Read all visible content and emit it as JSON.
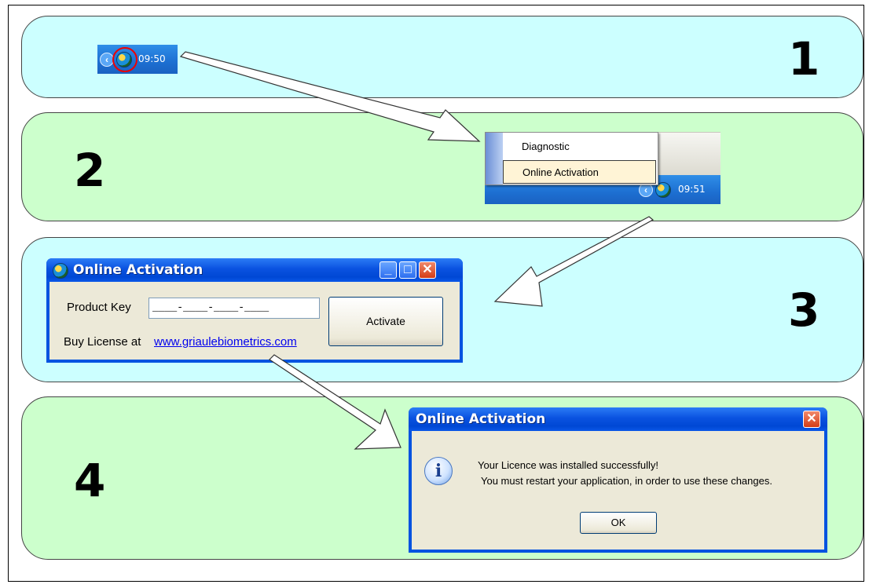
{
  "steps": [
    "1",
    "2",
    "3",
    "4"
  ],
  "step1": {
    "tray_time": "09:50"
  },
  "step2": {
    "menu_items": [
      "Diagnostic",
      "Online Activation"
    ],
    "tray_time": "09:51"
  },
  "step3": {
    "window_title": "Online Activation",
    "product_key_label": "Product Key",
    "product_key_value": "____-____-____-____",
    "activate_label": "Activate",
    "buy_license_text": "Buy License at",
    "buy_license_link": "www.griaulebiometrics.com",
    "minimize_glyph": "_",
    "maximize_glyph": "□",
    "close_glyph": "✕"
  },
  "step4": {
    "window_title": "Online Activation",
    "message_line1": "Your Licence was installed successfully!",
    "message_line2": "You must restart your application, in order to use these changes.",
    "ok_label": "OK",
    "close_glyph": "✕",
    "info_glyph": "i"
  },
  "chevron_glyph": "‹",
  "colors": {
    "panel_cyan": "#ccffff",
    "panel_green": "#ccffcc",
    "xp_title_blue": "#0a52e0",
    "xp_client": "#ece9d8",
    "red_highlight": "#e00000"
  },
  "icons": [
    "globe-app-icon",
    "info-icon",
    "close-icon",
    "minimize-icon",
    "maximize-icon",
    "chevron-left-icon"
  ]
}
